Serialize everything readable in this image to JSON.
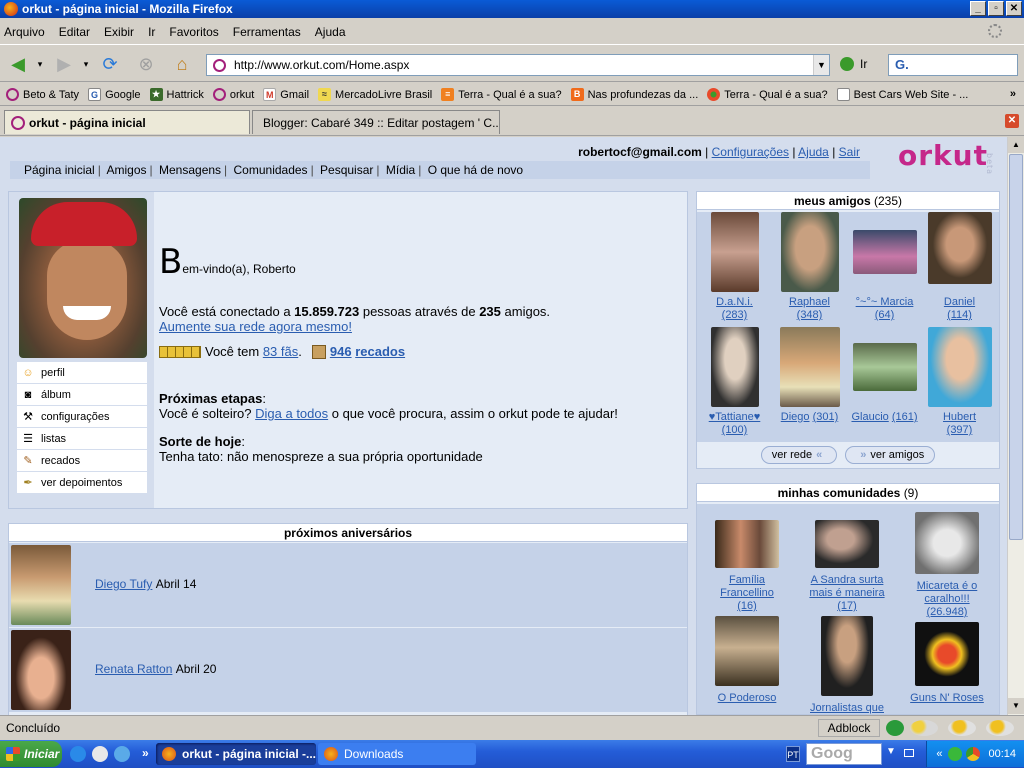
{
  "window": {
    "title": "orkut - página inicial - Mozilla Firefox",
    "btn_min": "_",
    "btn_max": "▫",
    "btn_close": "✕"
  },
  "menu": [
    "Arquivo",
    "Editar",
    "Exibir",
    "Ir",
    "Favoritos",
    "Ferramentas",
    "Ajuda"
  ],
  "nav": {
    "url": "http://www.orkut.com/Home.aspx",
    "go_label": "Ir",
    "search_value": "G."
  },
  "bookmarks": [
    {
      "label": "Beto & Taty"
    },
    {
      "label": "Google"
    },
    {
      "label": "Hattrick"
    },
    {
      "label": "orkut"
    },
    {
      "label": "Gmail"
    },
    {
      "label": "MercadoLivre Brasil"
    },
    {
      "label": "Terra - Qual é a sua?"
    },
    {
      "label": "Nas profundezas da ..."
    },
    {
      "label": "Terra - Qual é a sua?"
    },
    {
      "label": "Best Cars Web Site - ..."
    }
  ],
  "bookmarks_more": "»",
  "tabs": [
    {
      "label": "orkut - página inicial"
    },
    {
      "label": "Blogger: Cabaré 349 :: Editar postagem ' C..."
    }
  ],
  "header": {
    "email": "robertocf@gmail.com",
    "links": [
      "Configurações",
      "Ajuda",
      "Sair"
    ],
    "logo": "orkut",
    "logo_badge": "beta"
  },
  "topnav": [
    "Página inicial",
    "Amigos",
    "Mensagens",
    "Comunidades",
    "Pesquisar",
    "Mídia",
    "O que há de novo"
  ],
  "sidemenu": [
    "perfil",
    "álbum",
    "configurações",
    "listas",
    "recados",
    "ver depoimentos"
  ],
  "welcome": {
    "first_letter": "B",
    "rest": "em-vindo(a), Roberto"
  },
  "connected": {
    "pre": "Você está conectado a ",
    "people": "15.859.723",
    "mid": " pessoas através de ",
    "friends": "235",
    "post": " amigos.",
    "link": "Aumente sua rede agora mesmo!"
  },
  "fans": {
    "pre": "Você tem ",
    "fans_link": "83 fãs",
    "post": ".",
    "scraps_count": "946",
    "scraps_label": "recados"
  },
  "steps": {
    "title": "Próximas etapas",
    "colon": ":",
    "pre": "Você é solteiro? ",
    "link": "Diga a todos",
    "post": " o que você procura, assim o orkut pode te ajudar!"
  },
  "luck": {
    "title": "Sorte de hoje",
    "colon": ":",
    "text": "Tenha tato: não menospreze a sua própria oportunidade"
  },
  "birthdays": {
    "title": "próximos aniversários",
    "items": [
      {
        "name": "Diego Tufy",
        "date": "Abril 14"
      },
      {
        "name": "Renata Ratton",
        "date": "Abril 20"
      }
    ]
  },
  "friends": {
    "title": "meus amigos",
    "count": "(235)",
    "items": [
      {
        "name": "D.a.N.i.",
        "count": "(283)"
      },
      {
        "name": "Raphael",
        "count": "(348)"
      },
      {
        "name": "°~°~ Marcia",
        "count": "(64)"
      },
      {
        "name": "Daniel",
        "count": "(114)"
      },
      {
        "name": "♥Tattiane♥",
        "count": "(100)"
      },
      {
        "name": "Diego",
        "count": "(301)"
      },
      {
        "name": "Glaucio",
        "count": "(161)"
      },
      {
        "name": "Hubert",
        "count": "(397)"
      }
    ],
    "btn_network": "ver rede",
    "btn_friends": "ver amigos",
    "arrows": "«",
    "arrows_r": "»"
  },
  "communities": {
    "title": "minhas comunidades",
    "count": "(9)",
    "items": [
      {
        "line1": "Família",
        "line2": "Francellino",
        "count": "(16)"
      },
      {
        "line1": "A Sandra surta",
        "line2": "mais é maneira",
        "count": "(17)"
      },
      {
        "line1": "Micareta é o",
        "line2": "caralho!!!",
        "count": "(26.948)"
      },
      {
        "line1": "O Poderoso",
        "line2": "",
        "count": ""
      },
      {
        "line1": "Jornalistas que",
        "line2": "",
        "count": ""
      },
      {
        "line1": "Guns N' Roses",
        "line2": "",
        "count": ""
      }
    ]
  },
  "status": {
    "text": "Concluído",
    "adblock": "Adblock"
  },
  "taskbar": {
    "start": "Iniciar",
    "more": "»",
    "btn1": "orkut - página inicial -...",
    "btn2": "Downloads",
    "lang": "PT",
    "google": "Goog",
    "tray_more": "«",
    "clock": "00:14"
  },
  "colors": {
    "accent": "#2a5db0",
    "logo": "#c5278a",
    "page_bg": "#d4dded"
  }
}
